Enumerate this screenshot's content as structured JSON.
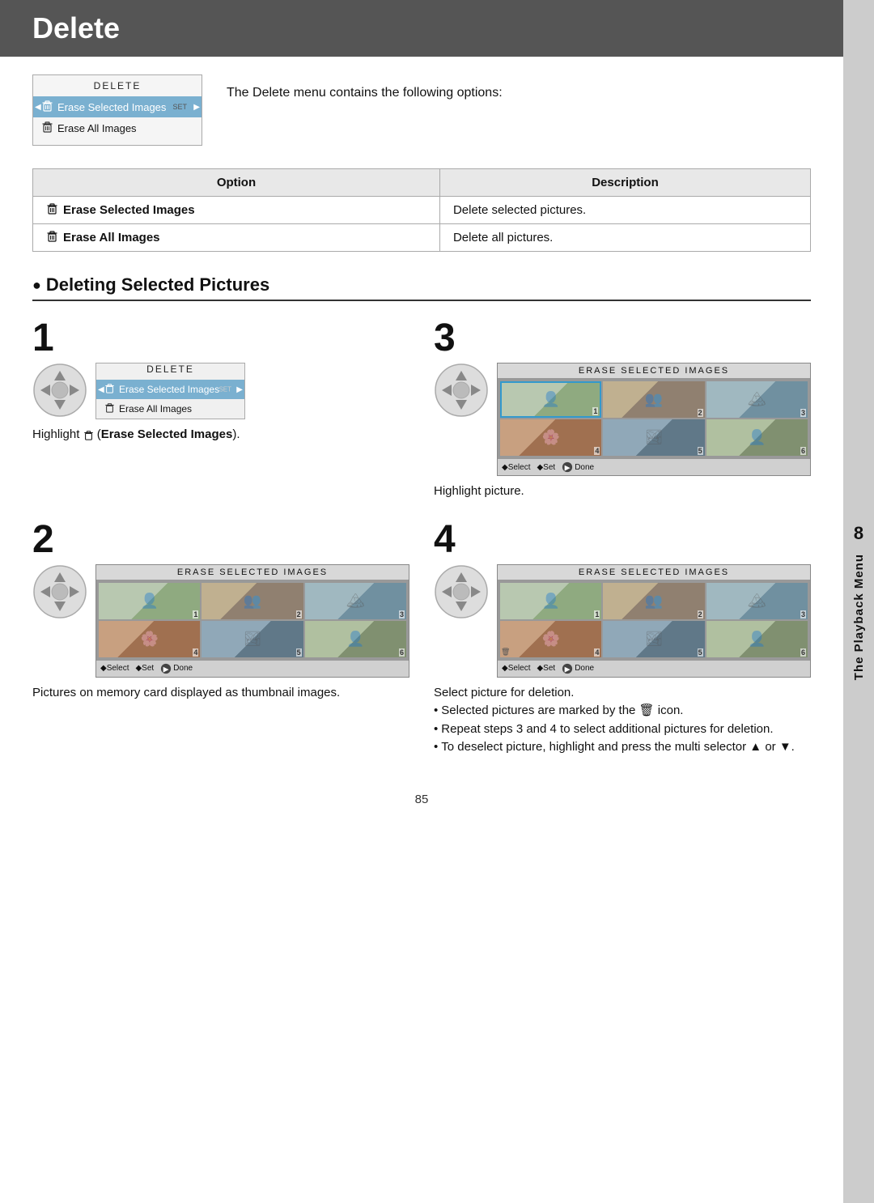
{
  "title": "Delete",
  "title_bg": "#555",
  "description": "The Delete menu contains the following options:",
  "menu": {
    "title": "DELETE",
    "items": [
      {
        "label": "Erase Selected Images",
        "selected": true,
        "set_label": "SET"
      },
      {
        "label": "Erase All Images",
        "selected": false
      }
    ]
  },
  "table": {
    "col1_header": "Option",
    "col2_header": "Description",
    "rows": [
      {
        "option": "Erase Selected Images",
        "description": "Delete selected pictures."
      },
      {
        "option": "Erase All Images",
        "description": "Delete all pictures."
      }
    ]
  },
  "section_heading": "Deleting Selected Pictures",
  "steps": [
    {
      "number": "1",
      "caption": "Highlight ☞ (Erase Selected Images).",
      "caption_bold": "Erase Selected Images"
    },
    {
      "number": "2",
      "caption": "Pictures on memory card displayed as thumbnail images."
    },
    {
      "number": "3",
      "caption": "Highlight picture."
    },
    {
      "number": "4",
      "caption": "Select picture for deletion."
    }
  ],
  "step4_bullets": [
    "Selected pictures are marked by the 🗑 icon.",
    "Repeat steps 3 and 4 to select additional pictures for deletion.",
    "To deselect picture, highlight and press the multi selector ▲ or ▼."
  ],
  "erase_screen_title": "ERASE SELECTED IMAGES",
  "delete_screen_title": "DELETE",
  "screen_footer": {
    "select": "◆Select",
    "set": "◆Set",
    "done": "Done"
  },
  "side_tab": {
    "number": "8",
    "text": "The Playback Menu"
  },
  "page_number": "85"
}
